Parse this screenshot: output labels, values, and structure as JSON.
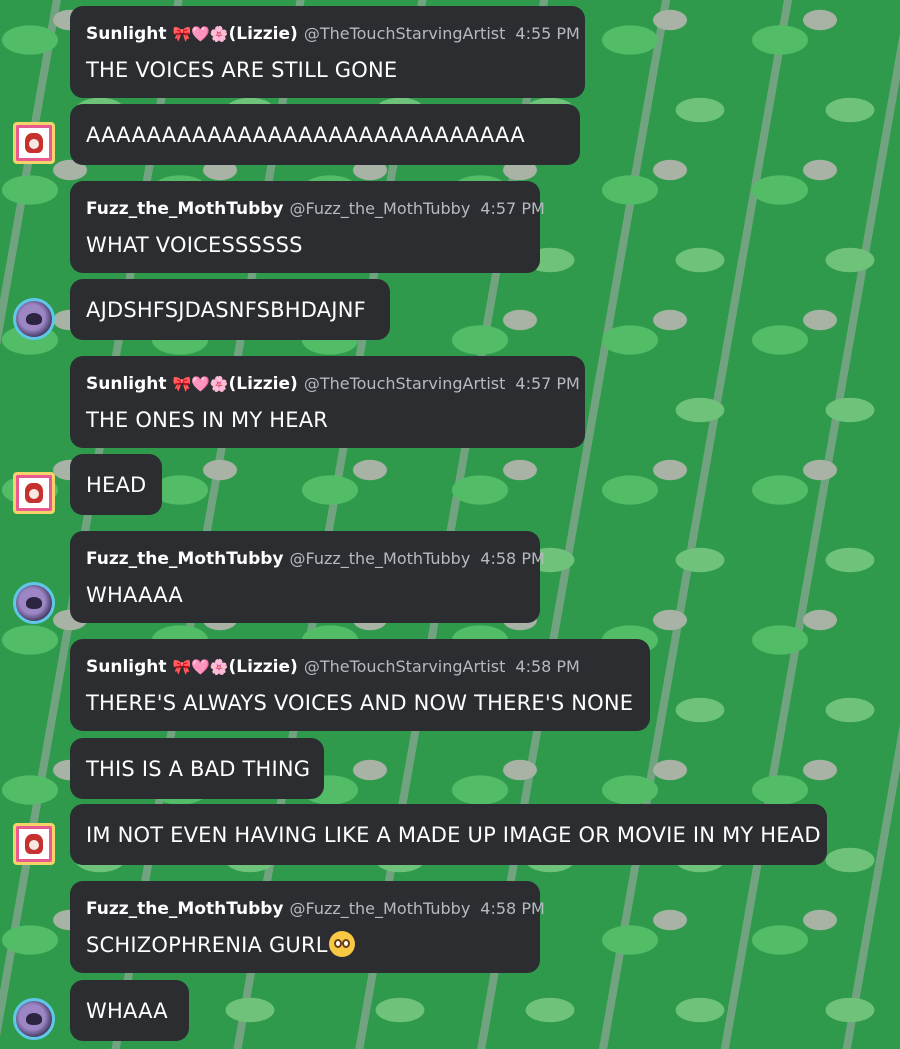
{
  "users": {
    "sunlight": {
      "name": "Sunlight",
      "emoji": "🎀🩷🌸",
      "suffix": "(Lizzie)",
      "handle": "@TheTouchStarvingArtist"
    },
    "fuzz": {
      "name": "Fuzz_the_MothTubby",
      "handle": "@Fuzz_the_MothTubby"
    }
  },
  "messages": [
    {
      "time": "4:55 PM",
      "text": "THE VOICES ARE STILL GONE"
    },
    {
      "text": "AAAAAAAAAAAAAAAAAAAAAAAAAAAAA"
    },
    {
      "time": "4:57 PM",
      "text": "WHAT VOICESSSSSS"
    },
    {
      "text": "AJDSHFSJDASNFSBHDAJNF"
    },
    {
      "time": "4:57 PM",
      "text": "THE ONES IN MY HEAR"
    },
    {
      "text": "HEAD"
    },
    {
      "time": "4:58 PM",
      "text": "WHAAAA"
    },
    {
      "time": "4:58 PM",
      "text": "THERE'S ALWAYS VOICES AND NOW THERE'S NONE"
    },
    {
      "text": "THIS IS A BAD THING"
    },
    {
      "text": "IM NOT EVEN HAVING LIKE A MADE UP IMAGE OR MOVIE IN MY HEAD"
    },
    {
      "time": "4:58 PM",
      "text": "SCHIZOPHRENIA GURL",
      "emoji": "pleading-face"
    },
    {
      "text": "WHAAA"
    }
  ]
}
